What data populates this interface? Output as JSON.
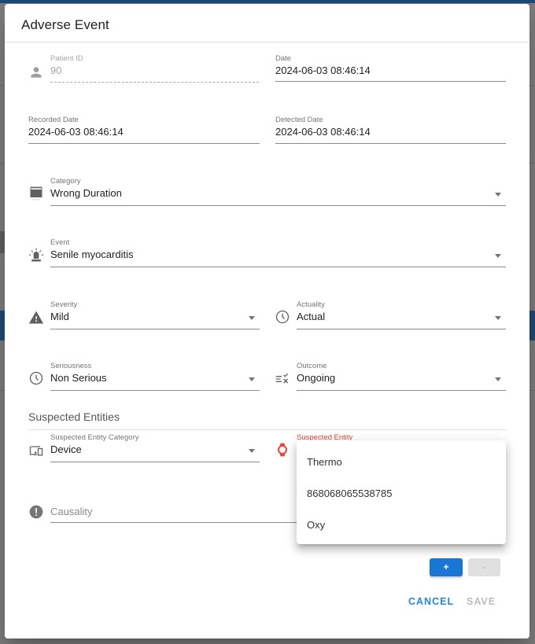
{
  "dialog": {
    "title": "Adverse Event"
  },
  "fields": {
    "patient_id": {
      "label": "Patient ID",
      "value": "90",
      "icon": "person-icon"
    },
    "date": {
      "label": "Date",
      "value": "2024-06-03 08:46:14"
    },
    "recorded_date": {
      "label": "Recorded Date",
      "value": "2024-06-03 08:46:14"
    },
    "detected_date": {
      "label": "Detected Date",
      "value": "2024-06-03 08:46:14"
    },
    "category": {
      "label": "Category",
      "value": "Wrong Duration",
      "icon": "calendar-view-icon"
    },
    "event": {
      "label": "Event",
      "value": "Senile myocarditis",
      "icon": "siren-icon"
    },
    "severity": {
      "label": "Severity",
      "value": "Mild",
      "icon": "warning-icon"
    },
    "actuality": {
      "label": "Actuality",
      "value": "Actual",
      "icon": "clock-icon"
    },
    "seriousness": {
      "label": "Seriousness",
      "value": "Non Serious",
      "icon": "clock-icon"
    },
    "outcome": {
      "label": "Outcome",
      "value": "Ongoing",
      "icon": "checklist-icon"
    },
    "suspected_entity_category": {
      "label": "Suspected Entity Category",
      "value": "Device",
      "icon": "devices-icon"
    },
    "suspected_entity": {
      "label": "Suspected Entity",
      "value": "",
      "icon": "watch-icon"
    },
    "causality": {
      "placeholder": "Causality",
      "icon": "error-icon"
    }
  },
  "section": {
    "suspected_entities_title": "Suspected Entities"
  },
  "suspected_entity_menu": {
    "options": [
      "Thermo",
      "868068065538785",
      "Oxy"
    ]
  },
  "buttons": {
    "add": "+",
    "remove": "-",
    "cancel": "CANCEL",
    "save": "SAVE"
  },
  "colors": {
    "primary": "#1976d2",
    "link": "#1e88e5",
    "error": "#f44336",
    "disabled": "#bdbdbd"
  }
}
